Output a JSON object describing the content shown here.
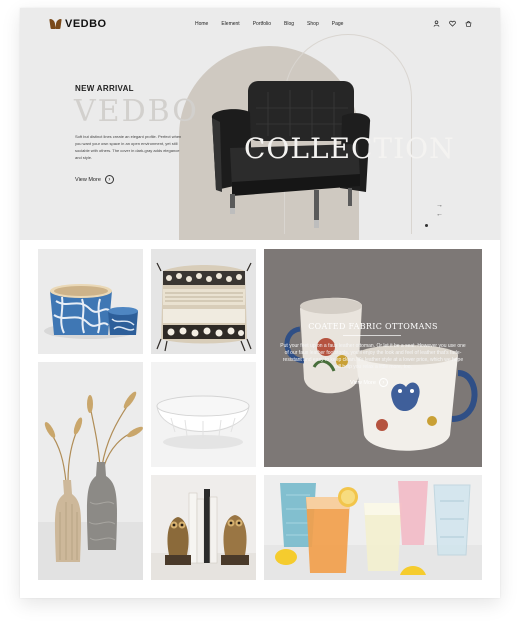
{
  "brand": {
    "name": "VEDBO"
  },
  "nav": {
    "items": [
      "Home",
      "Element",
      "Portfolio",
      "Blog",
      "Shop",
      "Page"
    ],
    "icons": [
      "user-icon",
      "heart-icon",
      "cart-icon"
    ]
  },
  "hero": {
    "eyebrow": "NEW ARRIVAL",
    "brand_large": "VEDBO",
    "description": "Soft but distinct lines create an elegant profile. Perfect when you want your own space in an open environment, yet still sociable with others. The cover in dark-gray adds elegance and style.",
    "cta": "View More",
    "overlay_title": "COLLECTION",
    "next_arrow": "→",
    "prev_arrow": "←"
  },
  "promo": {
    "title": "COATED FABRIC OTTOMANS",
    "text": "Put your feet up on a faux leather ottoman. Or let it be a seat. However you use one of our faux leather footstools, you'll enjoy the look and feel of leather that's fade-resistant and easy to keep clean. It's leather style at a lower price, which we hope will help you relax a little more, too.",
    "cta": "View More"
  },
  "colors": {
    "hero_bg": "#ebebeb",
    "arch": "#cfc9c1",
    "accent_brown": "#7a4a1a",
    "promo_overlay": "#7a7573"
  }
}
